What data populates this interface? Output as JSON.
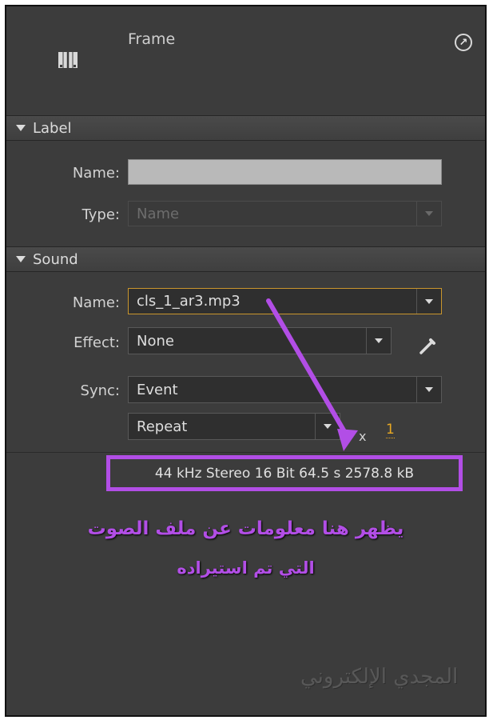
{
  "header": {
    "title": "Frame",
    "frame_icon": "frame-icon",
    "expand_icon": "circle-arrow-icon"
  },
  "label_section": {
    "title": "Label",
    "name_label": "Name:",
    "name_value": "",
    "type_label": "Type:",
    "type_value": "Name"
  },
  "sound_section": {
    "title": "Sound",
    "name_label": "Name:",
    "name_value": "cls_1_ar3.mp3",
    "effect_label": "Effect:",
    "effect_value": "None",
    "edit_icon": "pencil-icon",
    "sync_label": "Sync:",
    "sync_value": "Event",
    "repeat_value": "Repeat",
    "times_label": "x",
    "repeat_count": "1",
    "info": "44 kHz Stereo 16 Bit 64.5 s 2578.8 kB"
  },
  "annotation": {
    "line1": "يظهر هنا معلومات عن ملف الصوت",
    "line2": "التي تم استيراده",
    "color": "#b24ee6"
  },
  "watermark": "المجدي الإلكتروني"
}
